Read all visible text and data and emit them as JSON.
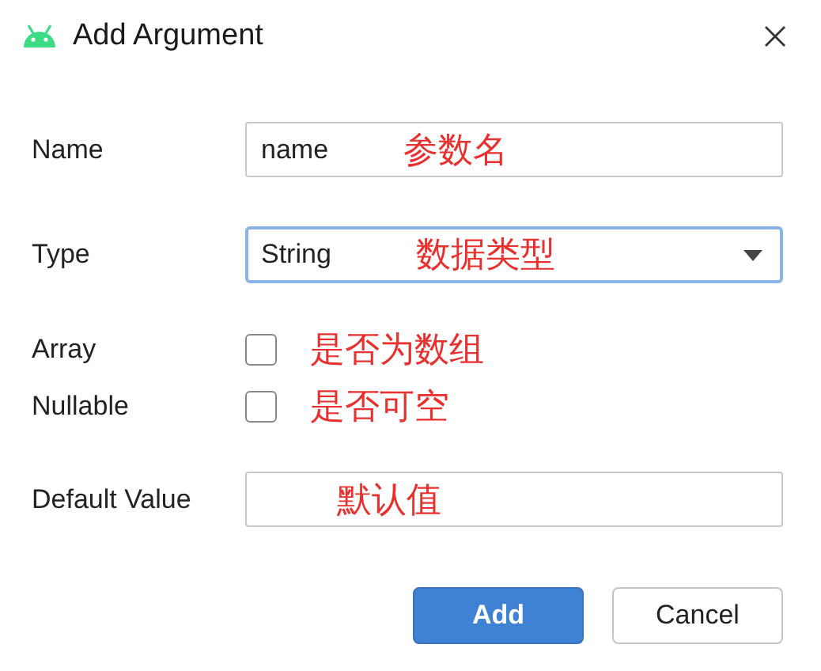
{
  "window": {
    "title": "Add Argument"
  },
  "fields": [
    {
      "kind": "text",
      "label": "Name",
      "value": "name",
      "annotation": "参数名"
    },
    {
      "kind": "dropdown",
      "label": "Type",
      "value": "String",
      "focused": true,
      "annotation": "数据类型"
    },
    {
      "kind": "checkbox",
      "label": "Array",
      "checked": false,
      "annotation": "是否为数组"
    },
    {
      "kind": "checkbox",
      "label": "Nullable",
      "checked": false,
      "annotation": "是否可空"
    },
    {
      "kind": "text",
      "label": "Default Value",
      "annotation": "默认值"
    }
  ],
  "buttons": [
    {
      "label": "Add",
      "primary": true
    },
    {
      "label": "Cancel",
      "primary": false
    }
  ]
}
